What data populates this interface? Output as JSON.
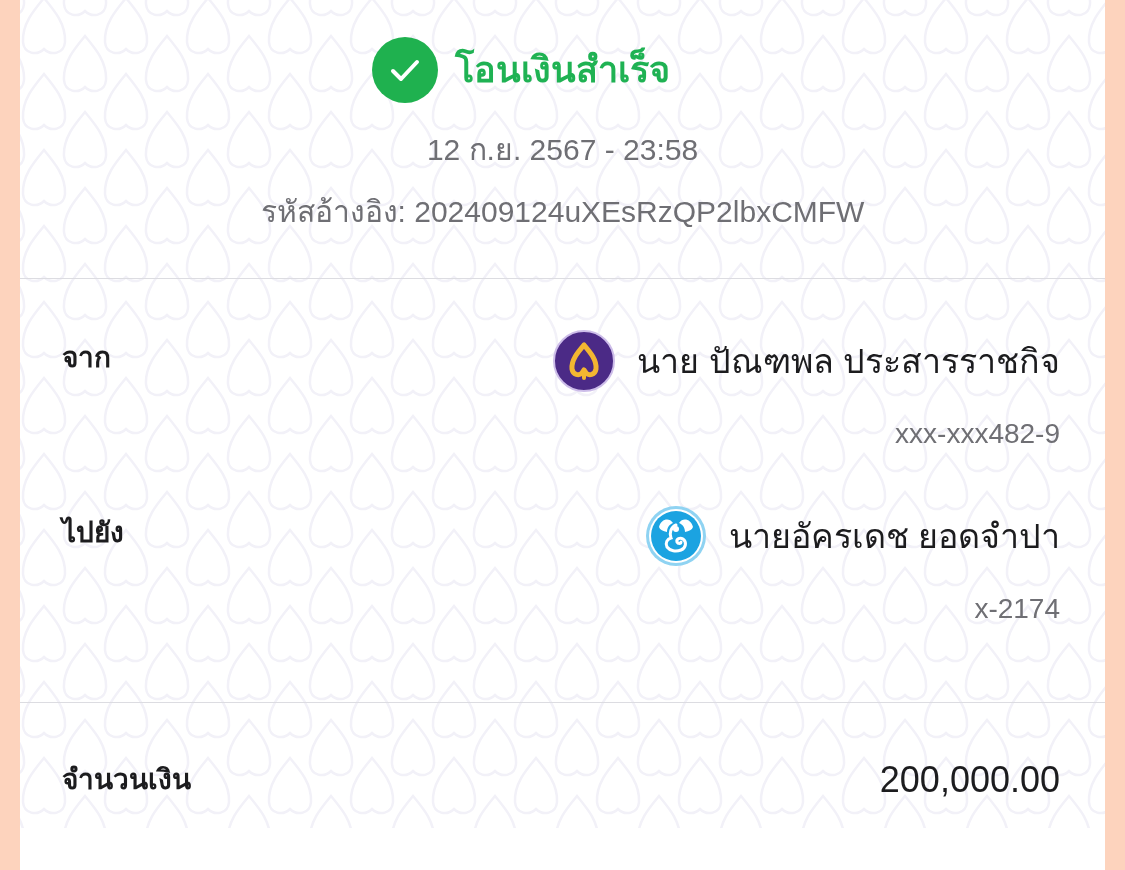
{
  "header": {
    "title": "โอนเงินสำเร็จ",
    "datetime": "12 ก.ย. 2567 - 23:58",
    "reference": "รหัสอ้างอิง: 202409124uXEsRzQP2lbxCMFW"
  },
  "parties": [
    {
      "label": "จาก",
      "kind": "leaf",
      "name": "นาย ปัณฑพล ประสารราชกิจ",
      "account": "xxx-xxx482-9"
    },
    {
      "label": "ไปยัง",
      "kind": "bird",
      "name": "นายอัครเดช ยอดจำปา",
      "account": "x-2174"
    }
  ],
  "amount": {
    "label": "จำนวนเงิน",
    "value": "200,000.00"
  }
}
